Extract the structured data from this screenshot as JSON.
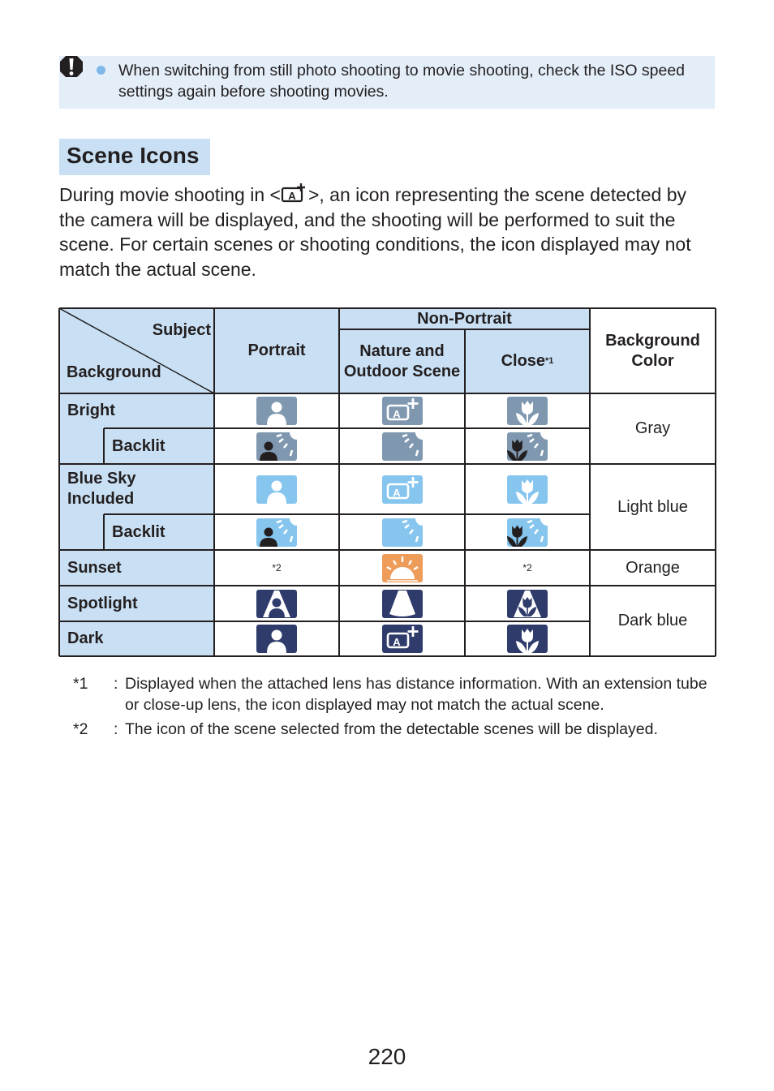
{
  "caution": {
    "icon": "caution-exclamation-icon",
    "text": "When switching from still photo shooting to movie shooting, check the ISO speed settings again before shooting movies."
  },
  "section": {
    "title": "Scene Icons",
    "intro_before": "During movie shooting in <",
    "intro_mode_icon": "scene-intelligent-auto-icon",
    "intro_after": ">, an icon representing the scene detected by the camera will be displayed, and the shooting will be performed to suit the scene. For certain scenes or shooting conditions, the icon displayed may not match the actual scene."
  },
  "table": {
    "header": {
      "subject": "Subject",
      "background": "Background",
      "portrait": "Portrait",
      "non_portrait": "Non-Portrait",
      "nature": "Nature and Outdoor Scene",
      "close": "Close",
      "close_sup": "*1",
      "bg_color": "Background Color"
    },
    "colors": {
      "gray": "#7f98b0",
      "lightblue": "#85c5ee",
      "orange": "#ee9c5a",
      "darkblue": "#2e3b6b"
    },
    "rows": [
      {
        "label": "Bright",
        "icons": [
          "person",
          "auto",
          "flower"
        ],
        "color": "gray"
      },
      {
        "label": "Backlit",
        "icons": [
          "backlit-person",
          "backlit",
          "backlit-flower"
        ],
        "color": "gray"
      },
      {
        "label": "Blue Sky Included",
        "icons": [
          "person",
          "auto",
          "flower"
        ],
        "color": "lightblue"
      },
      {
        "label": "Backlit",
        "icons": [
          "backlit-person",
          "backlit",
          "backlit-flower"
        ],
        "color": "lightblue"
      },
      {
        "label": "Sunset",
        "icons": [
          "*2",
          "sunset",
          "*2"
        ],
        "color": "orange"
      },
      {
        "label": "Spotlight",
        "icons": [
          "spotlight-person",
          "spotlight",
          "spotlight-flower"
        ],
        "color": "darkblue"
      },
      {
        "label": "Dark",
        "icons": [
          "person",
          "auto",
          "flower"
        ],
        "color": "darkblue"
      }
    ],
    "bg_colors": [
      "Gray",
      "Light blue",
      "Orange",
      "Dark blue"
    ]
  },
  "notes": [
    {
      "mark": "*1",
      "text": "Displayed when the attached lens has distance information. With an extension tube or close-up lens, the icon displayed may not match the actual scene."
    },
    {
      "mark": "*2",
      "text": "The icon of the scene selected from the detectable scenes will be displayed."
    }
  ],
  "page_number": "220"
}
